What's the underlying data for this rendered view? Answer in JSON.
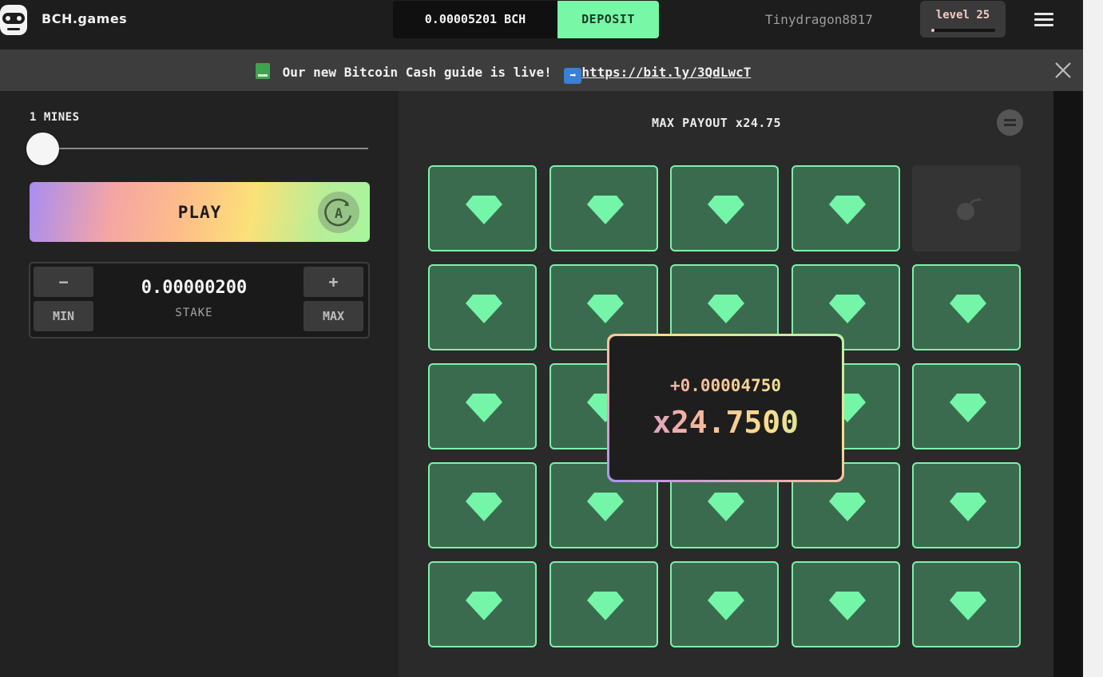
{
  "header": {
    "brand": "BCH.games",
    "balance": "0.00005201 BCH",
    "deposit_label": "DEPOSIT",
    "username": "Tinydragon8817",
    "level_label": "level 25",
    "level_progress": 0.05
  },
  "announcement": {
    "text": " Our new Bitcoin Cash guide is live! ",
    "link": "https://bit.ly/3QdLwcT"
  },
  "controls": {
    "mines_label": "1 MINES",
    "mines_value": 1,
    "mines_max": 24,
    "play_label": "PLAY",
    "auto_label": "A",
    "minus_label": "−",
    "plus_label": "+",
    "min_label": "MIN",
    "max_label": "MAX",
    "stake_value": "0.00000200",
    "stake_label": "STAKE"
  },
  "game": {
    "max_payout": "MAX PAYOUT x24.75",
    "grid": [
      [
        "gem",
        "gem",
        "gem",
        "gem",
        "mine"
      ],
      [
        "gem",
        "gem",
        "gem",
        "gem",
        "gem"
      ],
      [
        "gem",
        "gem",
        "gem",
        "gem",
        "gem"
      ],
      [
        "gem",
        "gem",
        "gem",
        "gem",
        "gem"
      ],
      [
        "gem",
        "gem",
        "gem",
        "gem",
        "gem"
      ]
    ],
    "win": {
      "gain": "+0.00004750",
      "multiplier": "x24.7500"
    }
  },
  "colors": {
    "accent": "#78f7a7",
    "gem": "#74f5a8",
    "tile_bg": "#3b6b4e"
  }
}
